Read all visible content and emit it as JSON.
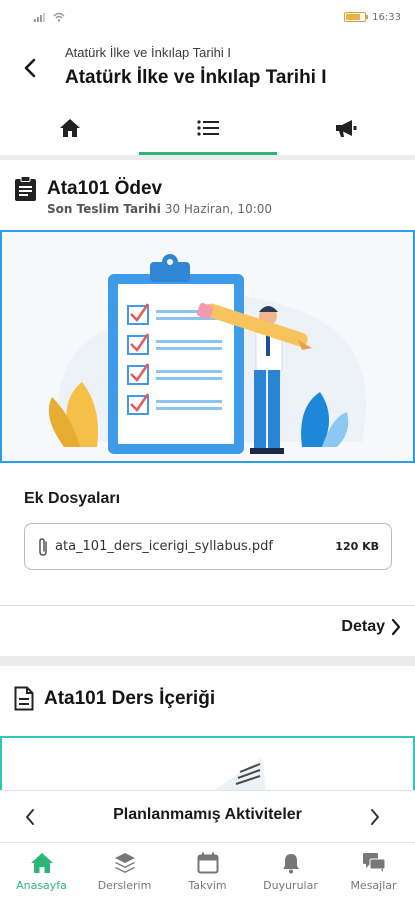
{
  "status_bar": {
    "time": "16:33"
  },
  "header": {
    "subtitle": "Atatürk İlke ve İnkılap Tarihi I",
    "title": "Atatürk İlke ve İnkılap Tarihi I"
  },
  "tabs": [
    {
      "icon": "home-icon",
      "active": false
    },
    {
      "icon": "list-icon",
      "active": true
    },
    {
      "icon": "megaphone-icon",
      "active": false
    }
  ],
  "assignment": {
    "title": "Ata101 Ödev",
    "deadline_label": "Son Teslim Tarihi",
    "deadline_value": "30 Haziran, 10:00",
    "files_label": "Ek Dosyaları",
    "file": {
      "name": "ata_101_ders_icerigi_syllabus.pdf",
      "size": "120 KB"
    },
    "detail_label": "Detay"
  },
  "content_card": {
    "title": "Ata101 Ders İçeriği"
  },
  "pager": {
    "title": "Planlanmamış Aktiviteler"
  },
  "bottom_nav": [
    {
      "label": "Anasayfa",
      "icon": "home-icon",
      "active": true
    },
    {
      "label": "Derslerim",
      "icon": "layers-icon",
      "active": false
    },
    {
      "label": "Takvim",
      "icon": "calendar-icon",
      "active": false
    },
    {
      "label": "Duyurular",
      "icon": "bell-icon",
      "active": false
    },
    {
      "label": "Mesajlar",
      "icon": "chat-icon",
      "active": false
    }
  ],
  "colors": {
    "accent": "#2bb673",
    "illustration_border": "#2aa0e8",
    "preview_border": "#2ec7b8"
  }
}
